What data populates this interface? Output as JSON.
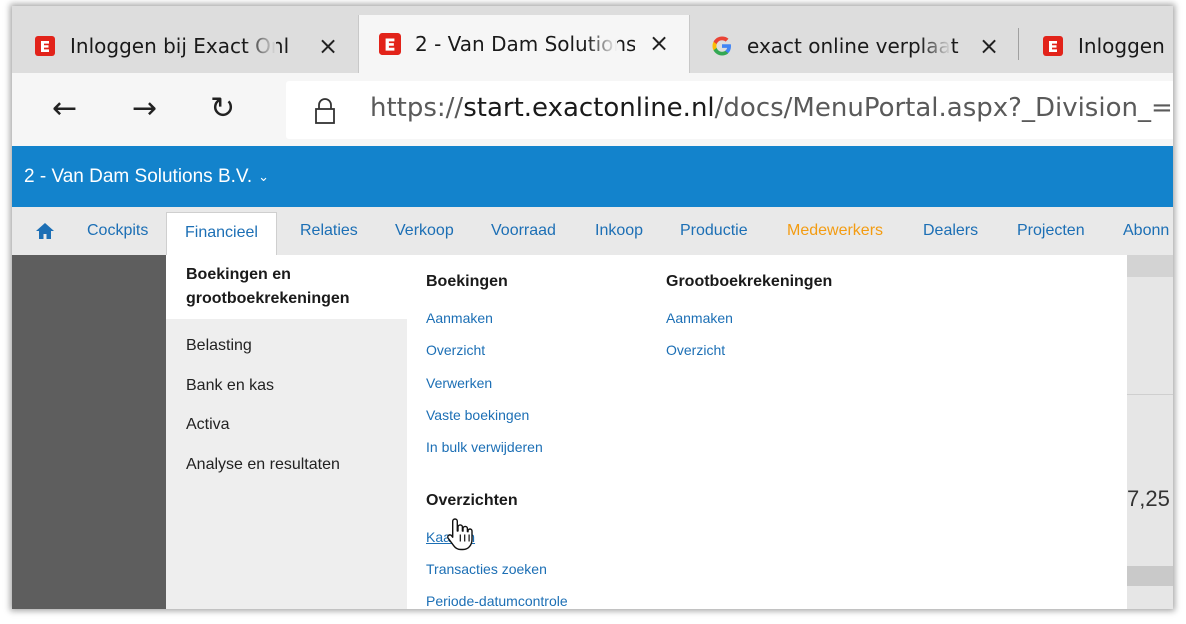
{
  "tabs": [
    {
      "title": "Inloggen bij Exact Onl",
      "close": "×",
      "icon": "exact-e-icon"
    },
    {
      "title": "2 - Van Dam Solutions",
      "close": "×",
      "icon": "exact-e-icon",
      "active": true
    },
    {
      "title": "exact online verplaat",
      "close": "×",
      "icon": "google-g-icon"
    },
    {
      "title": "Inloggen",
      "icon": "exact-e-icon"
    }
  ],
  "nav": {
    "back": "←",
    "forward": "→",
    "refresh": "↻",
    "url_scheme": "https://",
    "url_host": "start.exactonline.nl",
    "url_path": "/docs/MenuPortal.aspx?_Division_="
  },
  "company": {
    "name": "2 - Van Dam Solutions B.V.",
    "chevron": "⌄"
  },
  "menu": {
    "items": [
      "Cockpits",
      "Financieel",
      "Relaties",
      "Verkoop",
      "Voorraad",
      "Inkoop",
      "Productie",
      "Medewerkers",
      "Dealers",
      "Projecten",
      "Abonn"
    ],
    "selected": "Financieel"
  },
  "dropdown": {
    "left_header": "Boekingen en grootboekrekeningen",
    "left_items": [
      "Belasting",
      "Bank en kas",
      "Activa",
      "Analyse en resultaten"
    ],
    "col1": {
      "heading": "Boekingen",
      "links": [
        "Aanmaken",
        "Overzicht",
        "Verwerken",
        "Vaste boekingen",
        "In bulk verwijderen"
      ],
      "heading2": "Overzichten",
      "links2": [
        "Kaarten",
        "Transacties zoeken",
        "Periode-datumcontrole"
      ]
    },
    "col2": {
      "heading": "Grootboekrekeningen",
      "links": [
        "Aanmaken",
        "Overzicht"
      ]
    }
  },
  "background": {
    "partial_number": "7,25"
  },
  "colors": {
    "brand_blue": "#1383cc",
    "link_blue": "#1c6fb5",
    "orange": "#f39c12",
    "exact_red": "#e2231a"
  }
}
